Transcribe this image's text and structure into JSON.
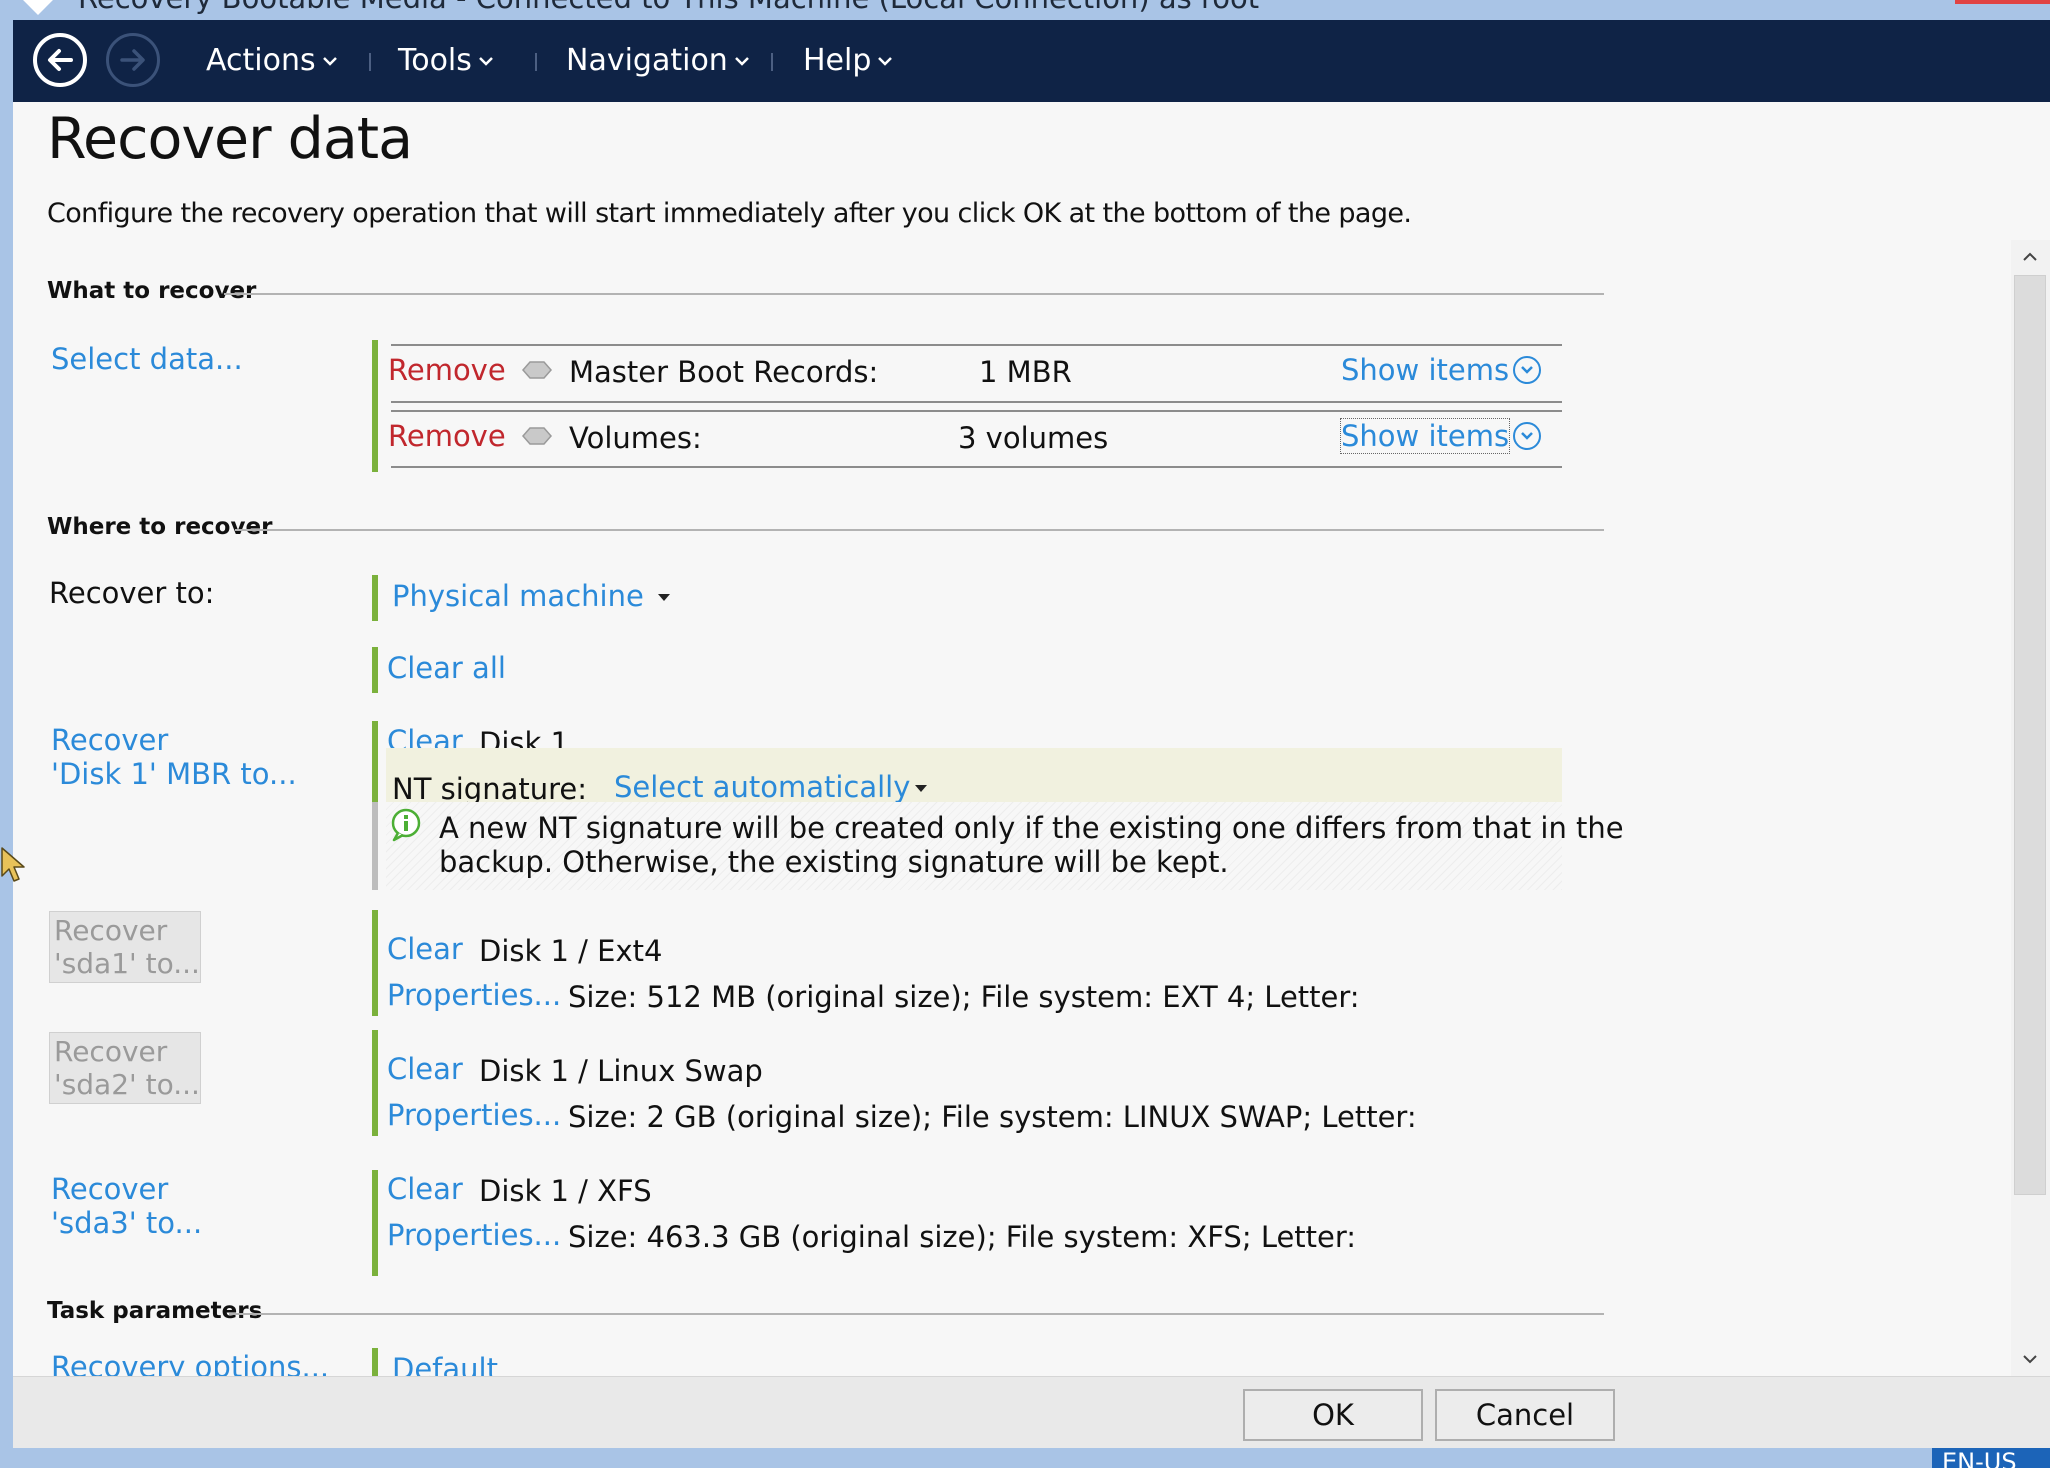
{
  "window": {
    "title": "Recovery Bootable Media - Connected to This Machine (Local Connection) as root"
  },
  "nav": {
    "menus": [
      "Actions",
      "Tools",
      "Navigation",
      "Help"
    ]
  },
  "page": {
    "title": "Recover data",
    "subtitle": "Configure the recovery operation that will start immediately after you click OK at the bottom of the page."
  },
  "what_to_recover": {
    "section_label": "What to recover",
    "select_link": "Select data...",
    "items": [
      {
        "remove": "Remove",
        "label": "Master Boot Records:",
        "value": "1 MBR",
        "show": "Show items"
      },
      {
        "remove": "Remove",
        "label": "Volumes:",
        "value": "3 volumes",
        "show": "Show items"
      }
    ]
  },
  "where_to_recover": {
    "section_label": "Where to recover",
    "recover_to_label": "Recover to:",
    "recover_to_value": "Physical machine",
    "clear_all": "Clear all",
    "mbr": {
      "left_link_line1": "Recover",
      "left_link_line2": "'Disk 1' MBR to...",
      "clear": "Clear",
      "target": "Disk 1",
      "nt_label": "NT signature:",
      "nt_value": "Select automatically",
      "info_line1": "A new NT signature will be created only if the existing one differs from that in the",
      "info_line2": "backup. Otherwise, the existing signature will be kept."
    },
    "volumes": [
      {
        "left_line1": "Recover",
        "left_line2": "'sda1' to...",
        "enabled": false,
        "clear": "Clear",
        "target": "Disk 1 / Ext4",
        "props": "Properties...",
        "details": "Size: 512 MB (original size); File system: EXT 4; Letter:"
      },
      {
        "left_line1": "Recover",
        "left_line2": "'sda2' to...",
        "enabled": false,
        "clear": "Clear",
        "target": "Disk 1 / Linux Swap",
        "props": "Properties...",
        "details": "Size: 2 GB (original size); File system: LINUX SWAP; Letter:"
      },
      {
        "left_line1": "Recover",
        "left_line2": "'sda3' to...",
        "enabled": true,
        "clear": "Clear",
        "target": "Disk 1 / XFS",
        "props": "Properties...",
        "details": "Size: 463.3 GB (original size); File system: XFS; Letter:"
      }
    ]
  },
  "task_parameters": {
    "section_label": "Task parameters",
    "options_link": "Recovery options...",
    "options_value": "Default"
  },
  "footer": {
    "ok": "OK",
    "cancel": "Cancel"
  },
  "taskbar": {
    "language": "EN-US"
  },
  "colors": {
    "navbar": "#0f2346",
    "link": "#2b8ad9",
    "remove": "#c1272d",
    "accent_bar": "#7bb13c",
    "window_frame": "#a9c4e6"
  }
}
